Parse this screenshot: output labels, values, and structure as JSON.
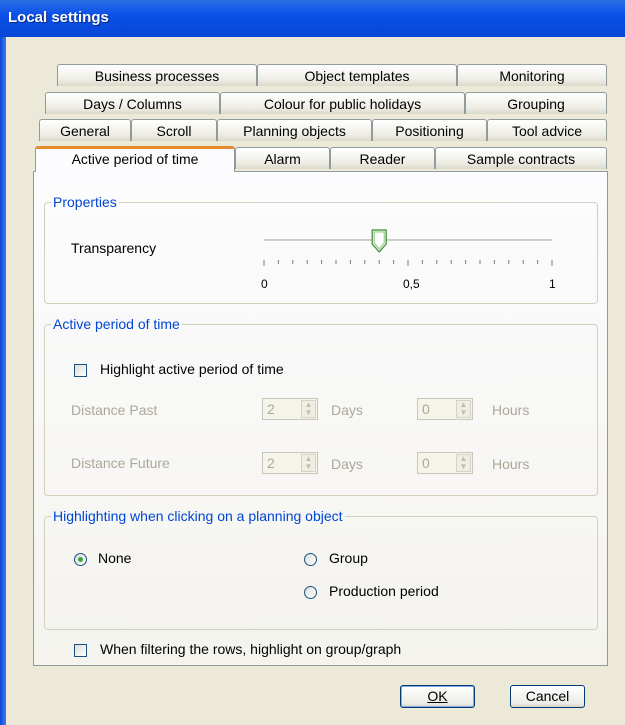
{
  "window": {
    "title": "Local settings"
  },
  "tabs": {
    "row1": [
      "Business processes",
      "Object templates",
      "Monitoring"
    ],
    "row2": [
      "Days / Columns",
      "Colour for public holidays",
      "Grouping"
    ],
    "row3": [
      "General",
      "Scroll",
      "Planning objects",
      "Positioning",
      "Tool advice"
    ],
    "row4": [
      "Active period of time",
      "Alarm",
      "Reader",
      "Sample contracts"
    ],
    "active": "Active period of time"
  },
  "properties": {
    "legend": "Properties",
    "transparency_label": "Transparency",
    "slider": {
      "min_label": "0",
      "mid_label": "0,5",
      "max_label": "1",
      "value": 0.4
    }
  },
  "active_period": {
    "legend": "Active period of time",
    "highlight_label": "Highlight active period of time",
    "highlight_checked": false,
    "distance_past": {
      "label": "Distance Past",
      "days_value": "2",
      "days_unit": "Days",
      "hours_value": "0",
      "hours_unit": "Hours"
    },
    "distance_future": {
      "label": "Distance Future",
      "days_value": "2",
      "days_unit": "Days",
      "hours_value": "0",
      "hours_unit": "Hours"
    }
  },
  "highlighting": {
    "legend": "Highlighting when clicking on a planning object",
    "options": [
      "None",
      "Group",
      "Production period"
    ],
    "selected": "None"
  },
  "filter_highlight": {
    "label": "When filtering the rows, highlight on group/graph",
    "checked": false
  },
  "buttons": {
    "ok": "OK",
    "cancel": "Cancel"
  }
}
